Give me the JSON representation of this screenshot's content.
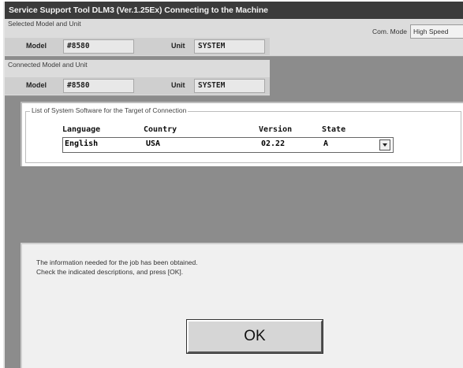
{
  "window": {
    "title": "Service Support Tool DLM3 (Ver.1.25Ex) Connecting to the Machine"
  },
  "selected": {
    "caption": "Selected Model and Unit",
    "model_label": "Model",
    "model_value": "#8580",
    "unit_label": "Unit",
    "unit_value": "SYSTEM"
  },
  "connected": {
    "caption": "Connected Model and Unit",
    "model_label": "Model",
    "model_value": "#8580",
    "unit_label": "Unit",
    "unit_value": "SYSTEM"
  },
  "com_mode": {
    "label": "Com. Mode",
    "value": "High Speed"
  },
  "software_list": {
    "caption": "List of System Software for the Target of Connection",
    "columns": [
      "Language",
      "Country",
      "Version",
      "State"
    ],
    "selected_row": {
      "language": "English",
      "country": "USA",
      "version": "02.22",
      "state": "A"
    }
  },
  "message": {
    "line1": "The information needed for the job has been obtained.",
    "line2": "Check the indicated descriptions, and press [OK]."
  },
  "ok_button": {
    "label": "OK"
  },
  "icons": {
    "dropdown": "chevron-down-icon"
  }
}
